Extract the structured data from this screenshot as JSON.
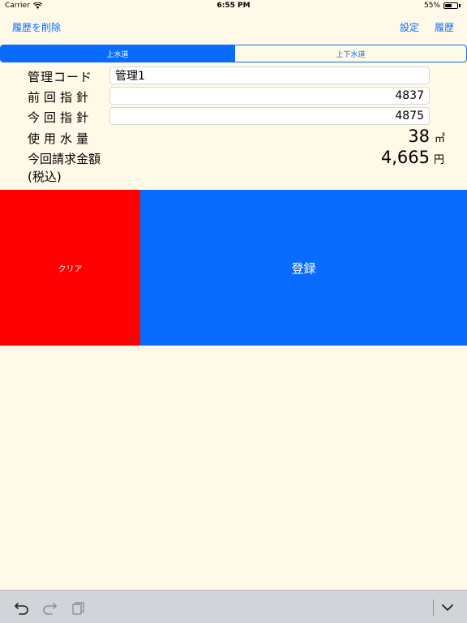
{
  "status_bar": {
    "carrier": "Carrier",
    "time": "6:55 PM",
    "battery_percent": "55%",
    "battery_level": 0.55
  },
  "navbar": {
    "delete_history": "履歴を削除",
    "settings": "設定",
    "history": "履歴"
  },
  "segments": [
    {
      "label": "上水道",
      "selected": true
    },
    {
      "label": "上下水道",
      "selected": false
    }
  ],
  "form": {
    "management_code": {
      "label": "管理コード",
      "value": "管理1"
    },
    "previous_reading": {
      "label": "前回指針",
      "value": "4837"
    },
    "current_reading": {
      "label": "今回指針",
      "value": "4875"
    },
    "usage": {
      "label": "使用水量",
      "value": "38",
      "unit": "㎥"
    },
    "charge": {
      "label": "今回請求金額",
      "sub_label": "(税込)",
      "value": "4,665",
      "unit": "円"
    }
  },
  "buttons": {
    "clear": "クリア",
    "register": "登録"
  },
  "colors": {
    "accent": "#0a6cff",
    "clear": "#ff0000",
    "background": "#fff9e8"
  },
  "keyboard_toolbar": {
    "icons": [
      "undo-icon",
      "redo-icon",
      "paste-icon",
      "chevron-down-icon"
    ]
  }
}
